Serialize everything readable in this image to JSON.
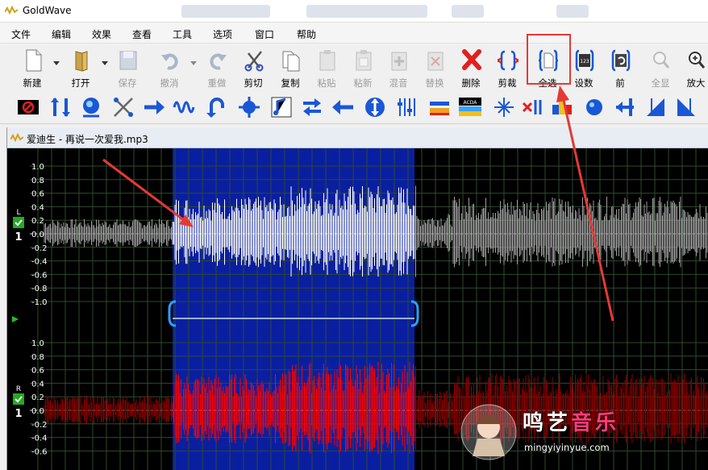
{
  "app": {
    "title": "GoldWave"
  },
  "menu": [
    "文件",
    "编辑",
    "效果",
    "查看",
    "工具",
    "选项",
    "窗口",
    "帮助"
  ],
  "toolbar": [
    {
      "label": "新建",
      "icon": "new-file-icon",
      "enabled": true,
      "dropdown": true
    },
    {
      "label": "打开",
      "icon": "open-folder-icon",
      "enabled": true,
      "dropdown": true
    },
    {
      "label": "保存",
      "icon": "save-disk-icon",
      "enabled": false
    },
    {
      "label": "撤消",
      "icon": "undo-icon",
      "enabled": false,
      "dropdown": true
    },
    {
      "label": "重做",
      "icon": "redo-icon",
      "enabled": false
    },
    {
      "label": "剪切",
      "icon": "scissors-icon",
      "enabled": true
    },
    {
      "label": "复制",
      "icon": "copy-icon",
      "enabled": true
    },
    {
      "label": "粘贴",
      "icon": "paste-icon",
      "enabled": false
    },
    {
      "label": "粘新",
      "icon": "paste-new-icon",
      "enabled": false
    },
    {
      "label": "混音",
      "icon": "mix-icon",
      "enabled": false
    },
    {
      "label": "替换",
      "icon": "replace-icon",
      "enabled": false
    },
    {
      "label": "删除",
      "icon": "delete-x-icon",
      "enabled": true
    },
    {
      "label": "剪裁",
      "icon": "trim-icon",
      "enabled": true
    },
    {
      "label": "全选",
      "icon": "select-all-icon",
      "enabled": true
    },
    {
      "label": "设数",
      "icon": "set-marker-icon",
      "enabled": true
    },
    {
      "label": "前",
      "icon": "previous-icon",
      "enabled": true
    },
    {
      "label": "全显",
      "icon": "zoom-all-icon",
      "enabled": false
    },
    {
      "label": "放大",
      "icon": "zoom-in-icon",
      "enabled": true
    }
  ],
  "effects_toolbar": [
    "stop-icon",
    "doppler-icon",
    "echo-icon",
    "filter-icon",
    "fade-in-icon",
    "flanger-icon",
    "undo-effect-icon",
    "compressor-icon",
    "pitch-icon",
    "mechanize-icon",
    "invert-icon",
    "reverse-icon",
    "offset-icon",
    "equalizer-icon",
    "playback-rate-icon",
    "volume-match-icon",
    "noise-icon",
    "silence-remove-icon",
    "spectrum-icon",
    "channel-mix-icon",
    "pan-icon",
    "volume-shape-icon",
    "fade-out-icon",
    "fade-icon"
  ],
  "document": {
    "title": "爱迪生 - 再说一次爱我.mp3"
  },
  "channels": [
    {
      "tag": "L",
      "number": "1",
      "color": "#9e9e9e",
      "selected_color": "#ffffff"
    },
    {
      "tag": "R",
      "number": "1",
      "color": "#8a0000",
      "selected_color": "#ff0000"
    }
  ],
  "axis_labels_top": [
    "1.0",
    "0.8",
    "0.6",
    "0.4",
    "0.2",
    "0.0",
    "-0.2",
    "-0.4",
    "-0.6",
    "-0.8",
    "-1.0"
  ],
  "axis_labels_bottom": [
    "1.0",
    "0.8",
    "0.6",
    "0.4",
    "0.2",
    "0.0",
    "-0.2",
    "-0.4",
    "-0.6"
  ],
  "watermark": {
    "brand_a": "鸣艺",
    "brand_b": "音乐",
    "url": "mingyiyinyue.com"
  },
  "colors": {
    "selection": "#0a1fa0",
    "highlight": "#e53935",
    "grid": "#2e4a2e",
    "channel_ok": "#22aa22"
  }
}
